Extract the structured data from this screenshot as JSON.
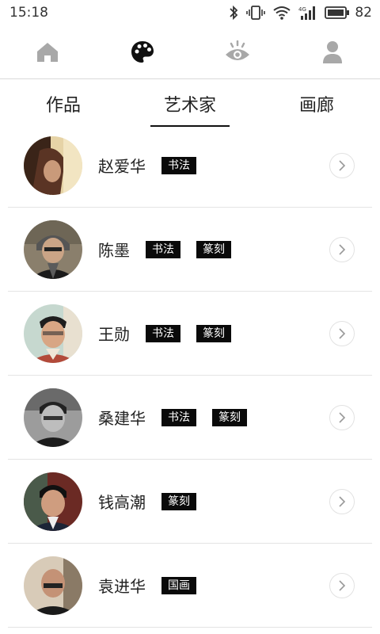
{
  "status_bar": {
    "time": "15:18",
    "battery_level": "82"
  },
  "nav_icons": [
    {
      "icon": "home-icon"
    },
    {
      "icon": "palette-icon"
    },
    {
      "icon": "eye-icon"
    },
    {
      "icon": "user-icon"
    }
  ],
  "tabs": [
    {
      "label": "作品"
    },
    {
      "label": "艺术家"
    },
    {
      "label": "画廊"
    }
  ],
  "artists": [
    {
      "name": "赵爱华",
      "tags": [
        "书法"
      ]
    },
    {
      "name": "陈墨",
      "tags": [
        "书法",
        "篆刻"
      ]
    },
    {
      "name": "王勋",
      "tags": [
        "书法",
        "篆刻"
      ]
    },
    {
      "name": "桑建华",
      "tags": [
        "书法",
        "篆刻"
      ]
    },
    {
      "name": "钱高潮",
      "tags": [
        "篆刻"
      ]
    },
    {
      "name": "袁进华",
      "tags": [
        "国画"
      ]
    }
  ]
}
